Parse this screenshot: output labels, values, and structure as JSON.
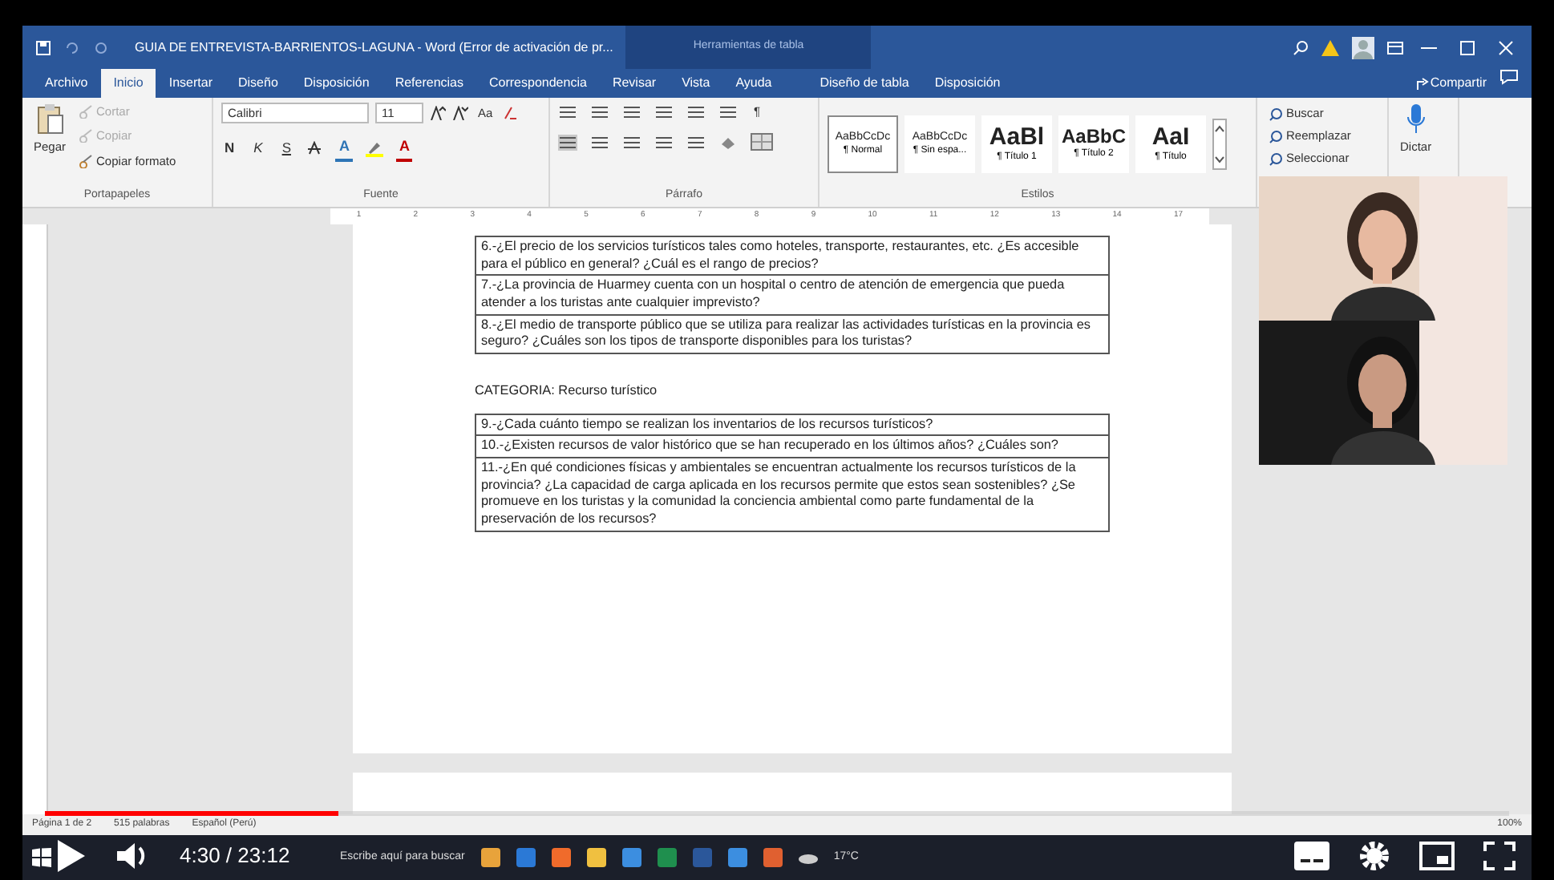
{
  "title_bar": {
    "title": "GUIA DE ENTREVISTA-BARRIENTOS-LAGUNA  -  Word (Error de activación de pr...",
    "context": "Herramientas de tabla"
  },
  "tabs": [
    {
      "label": "Archivo",
      "selected": false
    },
    {
      "label": "Inicio",
      "selected": true
    },
    {
      "label": "Insertar",
      "selected": false
    },
    {
      "label": "Diseño",
      "selected": false
    },
    {
      "label": "Disposición",
      "selected": false
    },
    {
      "label": "Referencias",
      "selected": false
    },
    {
      "label": "Correspondencia",
      "selected": false
    },
    {
      "label": "Revisar",
      "selected": false
    },
    {
      "label": "Vista",
      "selected": false
    },
    {
      "label": "Ayuda",
      "selected": false
    },
    {
      "label": "Diseño de tabla",
      "selected": false
    },
    {
      "label": "Disposición",
      "selected": false
    }
  ],
  "share": "Compartir",
  "clipboard": {
    "paste": "Pegar",
    "items": [
      {
        "label": "Cortar",
        "disabled": true
      },
      {
        "label": "Copiar",
        "disabled": true
      },
      {
        "label": "Copiar formato",
        "disabled": false
      }
    ],
    "group": "Portapapeles"
  },
  "font": {
    "name": "Calibri",
    "size": "11",
    "case": "Aa",
    "format": [
      {
        "label": "N",
        "kind": "bold"
      },
      {
        "label": "K",
        "kind": "italic"
      },
      {
        "label": "S",
        "kind": "underline"
      }
    ],
    "colors": [
      {
        "label": "A",
        "color": "#2e75b6"
      },
      {
        "label": "A",
        "color": "#c00000"
      }
    ],
    "group": "Fuente"
  },
  "paragraph": {
    "marks": "¶",
    "group": "Párrafo"
  },
  "styles": {
    "items": [
      {
        "preview": "AaBbCcDc",
        "name": "¶ Normal",
        "kind": "small",
        "selected": true
      },
      {
        "preview": "AaBbCcDc",
        "name": "¶ Sin espa...",
        "kind": "small",
        "selected": false
      },
      {
        "preview": "AaBl",
        "name": "¶ Título 1",
        "kind": "large",
        "selected": false
      },
      {
        "preview": "AaBbC",
        "name": "¶ Título 2",
        "kind": "medium",
        "selected": false
      },
      {
        "preview": "AaI",
        "name": "¶ Título",
        "kind": "large",
        "selected": false
      }
    ],
    "group": "Estilos"
  },
  "editing": [
    "Buscar",
    "Reemplazar",
    "Seleccionar"
  ],
  "dictate": "Dictar",
  "ruler": [
    "1",
    "2",
    "3",
    "4",
    "5",
    "6",
    "7",
    "8",
    "9",
    "10",
    "11",
    "12",
    "13",
    "14",
    "17"
  ],
  "document": {
    "table_1": [
      "6.-¿El precio de los servicios turísticos tales como hoteles, transporte, restaurantes, etc. ¿Es accesible para el público en general? ¿Cuál es el rango de precios?",
      "7.-¿La provincia de Huarmey cuenta con un hospital o centro de atención de emergencia que pueda atender a los turistas ante cualquier imprevisto?",
      "8.-¿El medio de transporte público que se utiliza para realizar las actividades turísticas en la provincia es seguro? ¿Cuáles son los tipos de transporte disponibles para los turistas?"
    ],
    "heading": "CATEGORIA: Recurso turístico",
    "table_2": [
      "9.-¿Cada cuánto tiempo se realizan los inventarios de los recursos turísticos?",
      "10.-¿Existen recursos de valor histórico que se han recuperado en los últimos años? ¿Cuáles son?",
      "11.-¿En qué condiciones físicas y ambientales se encuentran actualmente los recursos turísticos de la provincia? ¿La capacidad de carga aplicada en los recursos permite que estos sean sostenibles? ¿Se promueve en los turistas y la comunidad la conciencia ambiental como parte fundamental de la preservación de los recursos?"
    ]
  },
  "status_bar": {
    "page": "Página 1 de 2",
    "words": "515 palabras",
    "language": "Español (Perú)",
    "zoom": "100%"
  },
  "taskbar": {
    "search": "Escribe aquí para buscar",
    "weather": "17°C"
  },
  "player": {
    "time": "4:30 / 23:12",
    "level": 0.2
  }
}
